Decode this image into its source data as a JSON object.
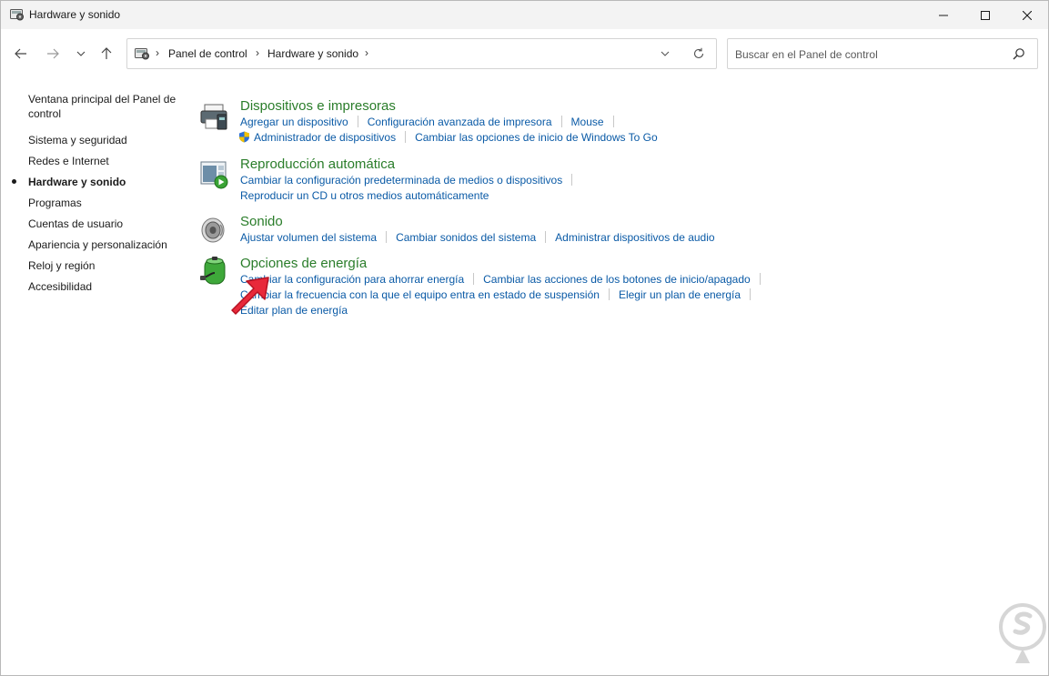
{
  "window": {
    "title": "Hardware y sonido"
  },
  "address": {
    "crumbs": [
      "Panel de control",
      "Hardware y sonido"
    ]
  },
  "search": {
    "placeholder": "Buscar en el Panel de control"
  },
  "sidebar": {
    "items": [
      {
        "label": "Ventana principal del Panel de control",
        "active": false
      },
      {
        "label": "Sistema y seguridad",
        "active": false
      },
      {
        "label": "Redes e Internet",
        "active": false
      },
      {
        "label": "Hardware y sonido",
        "active": true
      },
      {
        "label": "Programas",
        "active": false
      },
      {
        "label": "Cuentas de usuario",
        "active": false
      },
      {
        "label": "Apariencia y personalización",
        "active": false
      },
      {
        "label": "Reloj y región",
        "active": false
      },
      {
        "label": "Accesibilidad",
        "active": false
      }
    ]
  },
  "categories": {
    "devices": {
      "title": "Dispositivos e impresoras",
      "links": [
        "Agregar un dispositivo",
        "Configuración avanzada de impresora",
        "Mouse",
        "Administrador de dispositivos",
        "Cambiar las opciones de inicio de Windows To Go"
      ]
    },
    "autoplay": {
      "title": "Reproducción automática",
      "links": [
        "Cambiar la configuración predeterminada de medios o dispositivos",
        "Reproducir un CD u otros medios automáticamente"
      ]
    },
    "sound": {
      "title": "Sonido",
      "links": [
        "Ajustar volumen del sistema",
        "Cambiar sonidos del sistema",
        "Administrar dispositivos de audio"
      ]
    },
    "power": {
      "title": "Opciones de energía",
      "links": [
        "Cambiar la configuración para ahorrar energía",
        "Cambiar las acciones de los botones de inicio/apagado",
        "Cambiar la frecuencia con la que el equipo entra en estado de suspensión",
        "Elegir un plan de energía",
        "Editar plan de energía"
      ]
    }
  },
  "colors": {
    "category_title": "#2a7d2a",
    "link": "#0a5aa6",
    "arrow": "#e8293a"
  },
  "icons": [
    "control-panel-icon",
    "back-arrow-icon",
    "forward-arrow-icon",
    "recent-chevron-icon",
    "up-arrow-icon",
    "refresh-icon",
    "search-icon",
    "printer-icon",
    "autoplay-icon",
    "speaker-icon",
    "battery-icon",
    "shield-icon"
  ]
}
